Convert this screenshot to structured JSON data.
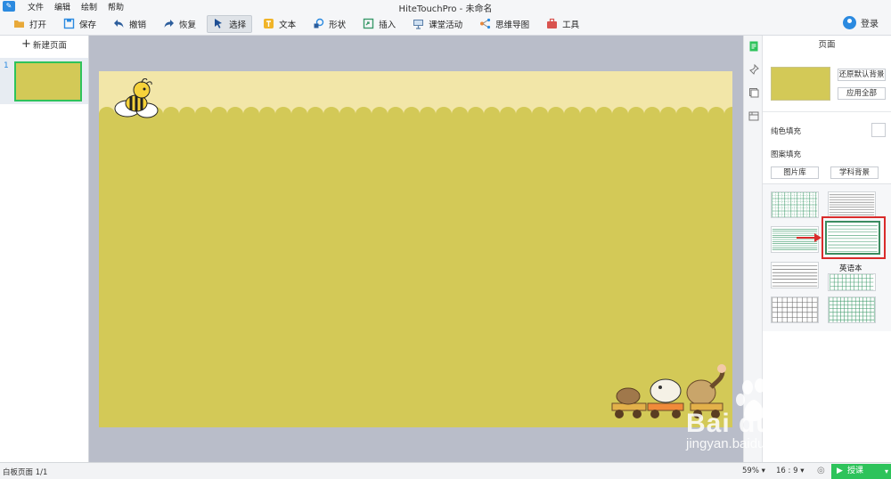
{
  "app": {
    "title": "HiteTouchPro - 未命名",
    "menu": [
      "文件",
      "编辑",
      "绘制",
      "帮助"
    ]
  },
  "toolbar": {
    "open": "打开",
    "save": "保存",
    "undo": "撤销",
    "redo": "恢复",
    "select": "选择",
    "text": "文本",
    "shape": "形状",
    "insert": "插入",
    "classroom": "课堂活动",
    "mindmap": "思维导图",
    "tools": "工具",
    "login": "登录"
  },
  "pages": {
    "new_page": "新建页面",
    "current_number": "1"
  },
  "panel": {
    "title": "页面",
    "restore_default_bg": "还原默认背景",
    "apply_all": "应用全部",
    "solid_fill": "纯色填充",
    "pattern_fill": "图案填充",
    "image_library": "图片库",
    "subject_bg": "学科背景",
    "tooltip": "英语本"
  },
  "status": {
    "page_info": "白板页面 1/1",
    "zoom": "59%",
    "ratio": "16 : 9",
    "start_class": "授课"
  },
  "colors": {
    "accent": "#2b8ae0",
    "slide_bg": "#d3c957",
    "slide_top": "#f2e6a8",
    "canvas_bg": "#b9bdc9",
    "green": "#2ec35b",
    "highlight": "#d92b2b"
  },
  "watermark": {
    "brand": "Bai du 经验",
    "url": "jingyan.baidu.com"
  }
}
